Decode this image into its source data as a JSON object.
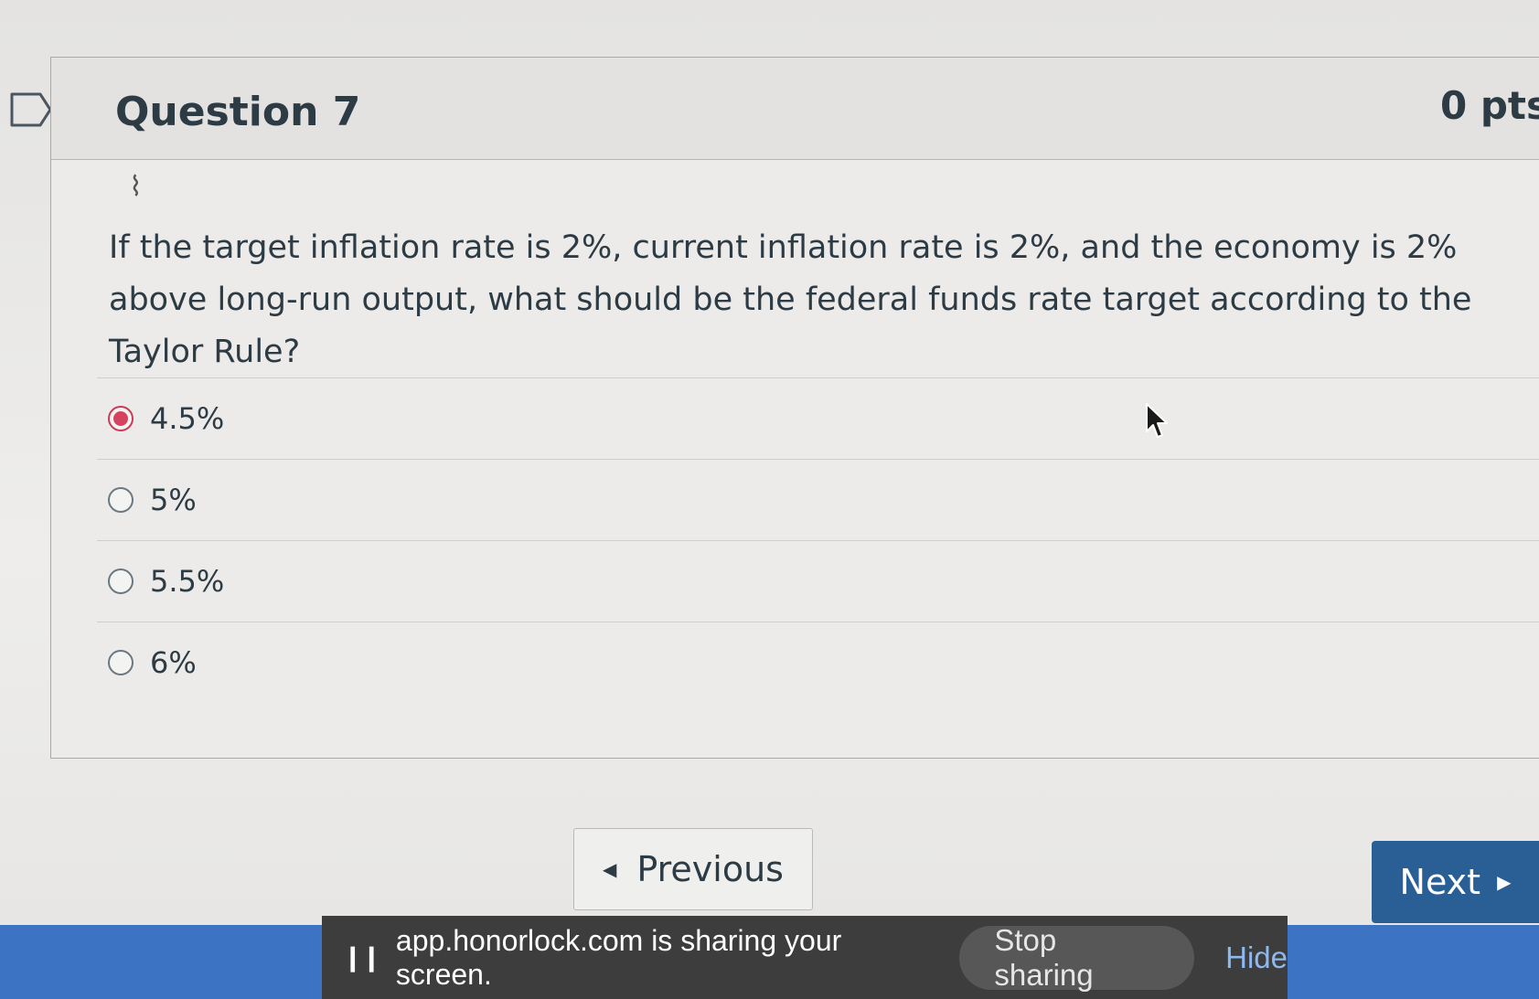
{
  "question": {
    "title": "Question 7",
    "points": "0 pts",
    "text": "If the target inflation rate is 2%, current inflation rate is 2%, and the economy is 2% above long-run output, what should be the federal funds rate target according to the Taylor Rule?",
    "answers": [
      {
        "label": "4.5%",
        "selected": true
      },
      {
        "label": "5%",
        "selected": false
      },
      {
        "label": "5.5%",
        "selected": false
      },
      {
        "label": "6%",
        "selected": false
      }
    ]
  },
  "navigation": {
    "previous_label": "Previous",
    "next_label": "Next"
  },
  "screen_share": {
    "message": "app.honorlock.com is sharing your screen.",
    "stop_label": "Stop sharing",
    "hide_label": "Hide"
  },
  "colors": {
    "accent_selected": "#d4435f",
    "next_button": "#2a5f95",
    "share_bar": "#3d3d3d",
    "taskbar": "#3c74c3"
  }
}
